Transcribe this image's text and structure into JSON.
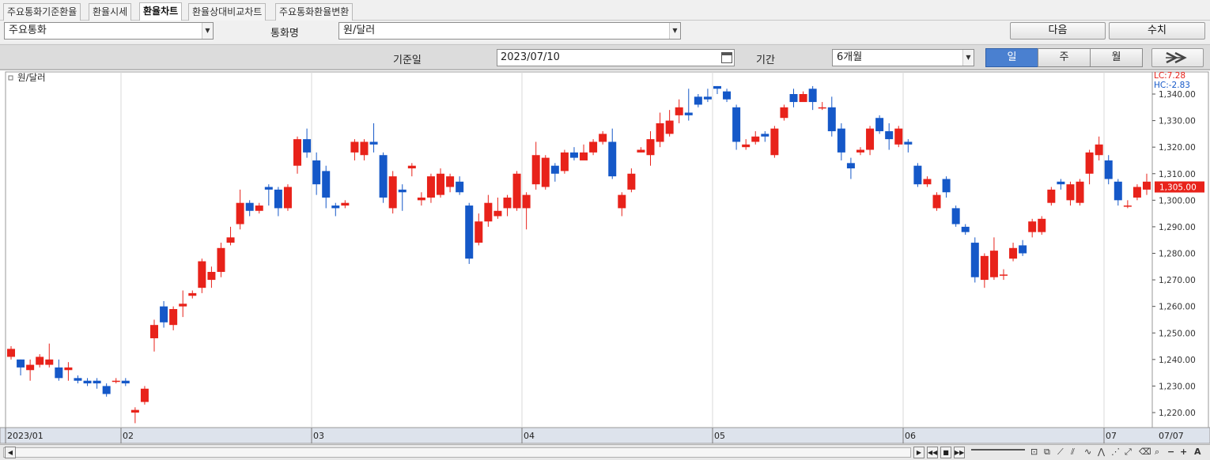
{
  "tabs": [
    {
      "label": "주요통화기준환율",
      "active": false
    },
    {
      "label": "환율시세",
      "active": false
    },
    {
      "label": "환율차트",
      "active": true
    },
    {
      "label": "환율상대비교차트",
      "active": false
    },
    {
      "label": "주요통화환율변환",
      "active": false
    }
  ],
  "toolbar": {
    "group_value": "주요통화",
    "currency_label": "통화명",
    "currency_value": "원/달러",
    "next_button": "다음",
    "values_button": "수치",
    "date_label": "기준일",
    "date_value": "2023/07/10",
    "period_label": "기간",
    "period_value": "6개월",
    "interval": [
      "일",
      "주",
      "월"
    ],
    "interval_active": "일",
    "forward_icon": "double-chevron-right-icon"
  },
  "colors": {
    "up": "#e8221a",
    "down": "#1558c8",
    "grid": "#d8d8d8",
    "current_bg": "#e8221a"
  },
  "chart_data": {
    "type": "candlestick",
    "series_label": "원/달러",
    "lc_label": "LC:7.28",
    "hc_label": "HC:-2.83",
    "current_value_label": "1,305.00",
    "current_value": 1305,
    "ylim": [
      1215,
      1345
    ],
    "y_ticks": [
      1220,
      1230,
      1240,
      1250,
      1260,
      1270,
      1280,
      1290,
      1300,
      1310,
      1320,
      1330,
      1340
    ],
    "y_tick_labels": [
      "1,220.00",
      "1,230.00",
      "1,240.00",
      "1,250.00",
      "1,260.00",
      "1,270.00",
      "1,280.00",
      "1,290.00",
      "1,300.00",
      "1,310.00",
      "1,320.00",
      "1,330.00",
      "1,340.00"
    ],
    "x_month_labels": [
      {
        "label": "2023/01",
        "index": 0
      },
      {
        "label": "02",
        "index": 12
      },
      {
        "label": "03",
        "index": 32
      },
      {
        "label": "04",
        "index": 54
      },
      {
        "label": "05",
        "index": 74
      },
      {
        "label": "06",
        "index": 94
      },
      {
        "label": "07",
        "index": 115
      }
    ],
    "x_end_label": "07/07",
    "candles": [
      [
        1241,
        1244,
        1240,
        1245
      ],
      [
        1240,
        1237,
        1234,
        1240
      ],
      [
        1236,
        1238,
        1232,
        1240
      ],
      [
        1238,
        1241,
        1237,
        1242
      ],
      [
        1238,
        1240,
        1237,
        1246
      ],
      [
        1237,
        1233,
        1232,
        1240
      ],
      [
        1236,
        1237,
        1232,
        1239
      ],
      [
        1233,
        1232,
        1231,
        1234
      ],
      [
        1232,
        1231,
        1230,
        1233
      ],
      [
        1232,
        1231,
        1229,
        1233
      ],
      [
        1230,
        1227,
        1226,
        1231
      ],
      [
        1232,
        1232,
        1231,
        1233
      ],
      [
        1232,
        1231,
        1230,
        1233
      ],
      [
        1220,
        1221,
        1216,
        1222
      ],
      [
        1224,
        1229,
        1223,
        1230
      ],
      [
        1248,
        1253,
        1243,
        1255
      ],
      [
        1260,
        1254,
        1252,
        1262
      ],
      [
        1253,
        1259,
        1251,
        1260
      ],
      [
        1260,
        1261,
        1256,
        1266
      ],
      [
        1264,
        1265,
        1263,
        1266
      ],
      [
        1267,
        1277,
        1265,
        1278
      ],
      [
        1270,
        1273,
        1267,
        1275
      ],
      [
        1273,
        1282,
        1271,
        1284
      ],
      [
        1284,
        1286,
        1283,
        1290
      ],
      [
        1291,
        1299,
        1289,
        1304
      ],
      [
        1299,
        1296,
        1294,
        1300
      ],
      [
        1296,
        1298,
        1295,
        1299
      ],
      [
        1305,
        1304,
        1298,
        1306
      ],
      [
        1304,
        1297,
        1294,
        1305
      ],
      [
        1297,
        1305,
        1296,
        1306
      ],
      [
        1313,
        1323,
        1310,
        1324
      ],
      [
        1323,
        1318,
        1316,
        1327
      ],
      [
        1315,
        1306,
        1302,
        1318
      ],
      [
        1311,
        1301,
        1297,
        1313
      ],
      [
        1298,
        1297,
        1294,
        1299
      ],
      [
        1298,
        1299,
        1297,
        1300
      ],
      [
        1318,
        1322,
        1315,
        1323
      ],
      [
        1317,
        1322,
        1315,
        1323
      ],
      [
        1322,
        1321,
        1318,
        1329
      ],
      [
        1317,
        1301,
        1299,
        1318
      ],
      [
        1297,
        1309,
        1295,
        1311
      ],
      [
        1304,
        1303,
        1296,
        1306
      ],
      [
        1312,
        1313,
        1309,
        1314
      ],
      [
        1300,
        1301,
        1298,
        1303
      ],
      [
        1301,
        1309,
        1299,
        1310
      ],
      [
        1302,
        1310,
        1301,
        1312
      ],
      [
        1305,
        1309,
        1303,
        1310
      ],
      [
        1307,
        1303,
        1302,
        1309
      ],
      [
        1298,
        1278,
        1276,
        1299
      ],
      [
        1284,
        1292,
        1283,
        1295
      ],
      [
        1292,
        1299,
        1290,
        1302
      ],
      [
        1294,
        1296,
        1293,
        1301
      ],
      [
        1297,
        1301,
        1294,
        1302
      ],
      [
        1297,
        1310,
        1296,
        1311
      ],
      [
        1297,
        1302,
        1289,
        1303
      ],
      [
        1306,
        1317,
        1304,
        1322
      ],
      [
        1305,
        1316,
        1304,
        1317
      ],
      [
        1313,
        1310,
        1307,
        1314
      ],
      [
        1311,
        1318,
        1310,
        1319
      ],
      [
        1318,
        1316,
        1315,
        1320
      ],
      [
        1315,
        1318,
        1316,
        1321
      ],
      [
        1318,
        1322,
        1317,
        1323
      ],
      [
        1322,
        1325,
        1321,
        1326
      ],
      [
        1322,
        1309,
        1308,
        1327
      ],
      [
        1297,
        1302,
        1294,
        1303
      ],
      [
        1304,
        1310,
        1303,
        1312
      ],
      [
        1318,
        1319,
        1318,
        1320
      ],
      [
        1317,
        1323,
        1313,
        1326
      ],
      [
        1322,
        1329,
        1320,
        1333
      ],
      [
        1325,
        1330,
        1324,
        1334
      ],
      [
        1332,
        1335,
        1329,
        1338
      ],
      [
        1333,
        1332,
        1330,
        1342
      ],
      [
        1339,
        1336,
        1335,
        1340
      ],
      [
        1339,
        1338,
        1337,
        1342
      ],
      [
        1343,
        1342,
        1340,
        1343
      ],
      [
        1341,
        1338,
        1337,
        1342
      ],
      [
        1335,
        1322,
        1319,
        1336
      ],
      [
        1320,
        1321,
        1319,
        1323
      ],
      [
        1322,
        1324,
        1321,
        1326
      ],
      [
        1325,
        1324,
        1322,
        1326
      ],
      [
        1317,
        1327,
        1316,
        1328
      ],
      [
        1331,
        1335,
        1330,
        1336
      ],
      [
        1340,
        1337,
        1335,
        1342
      ],
      [
        1337,
        1340,
        1338,
        1341
      ],
      [
        1342,
        1337,
        1334,
        1343
      ],
      [
        1335,
        1335,
        1334,
        1337
      ],
      [
        1335,
        1326,
        1324,
        1339
      ],
      [
        1327,
        1318,
        1315,
        1329
      ],
      [
        1314,
        1312,
        1308,
        1316
      ],
      [
        1318,
        1319,
        1317,
        1320
      ],
      [
        1319,
        1327,
        1317,
        1328
      ],
      [
        1331,
        1326,
        1325,
        1332
      ],
      [
        1326,
        1323,
        1319,
        1329
      ],
      [
        1321,
        1327,
        1320,
        1328
      ],
      [
        1322,
        1321,
        1318,
        1323
      ],
      [
        1313,
        1306,
        1305,
        1314
      ],
      [
        1306,
        1308,
        1305,
        1309
      ],
      [
        1297,
        1302,
        1296,
        1303
      ],
      [
        1308,
        1303,
        1301,
        1309
      ],
      [
        1297,
        1291,
        1290,
        1298
      ],
      [
        1290,
        1288,
        1287,
        1291
      ],
      [
        1284,
        1271,
        1269,
        1286
      ],
      [
        1270,
        1279,
        1267,
        1280
      ],
      [
        1271,
        1281,
        1270,
        1286
      ],
      [
        1272,
        1272,
        1270,
        1274
      ],
      [
        1278,
        1282,
        1277,
        1284
      ],
      [
        1283,
        1280,
        1279,
        1285
      ],
      [
        1288,
        1292,
        1286,
        1293
      ],
      [
        1288,
        1293,
        1287,
        1294
      ],
      [
        1299,
        1304,
        1298,
        1305
      ],
      [
        1307,
        1306,
        1304,
        1308
      ],
      [
        1300,
        1306,
        1298,
        1307
      ],
      [
        1299,
        1307,
        1298,
        1308
      ],
      [
        1310,
        1318,
        1306,
        1319
      ],
      [
        1317,
        1321,
        1315,
        1324
      ],
      [
        1315,
        1308,
        1306,
        1317
      ],
      [
        1307,
        1300,
        1298,
        1308
      ],
      [
        1298,
        1298,
        1297,
        1300
      ],
      [
        1301,
        1305,
        1300,
        1306
      ],
      [
        1304,
        1307,
        1302,
        1310
      ]
    ]
  }
}
